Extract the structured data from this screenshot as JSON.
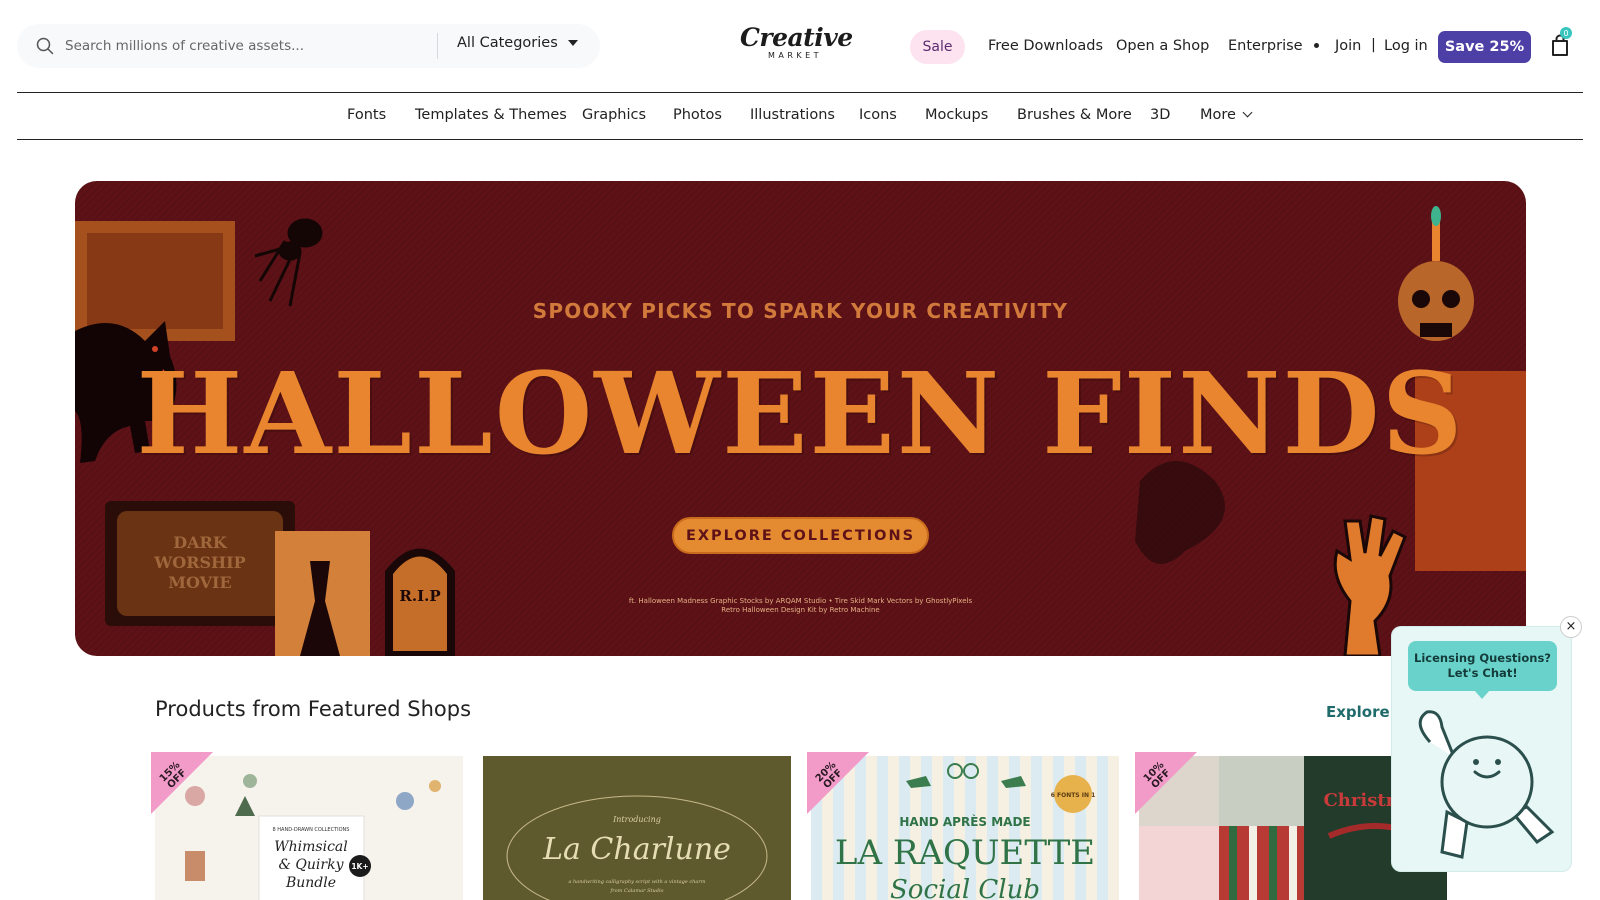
{
  "header": {
    "search": {
      "placeholder": "Search millions of creative assets...",
      "category": "All Categories"
    },
    "logo": {
      "line1": "Creative",
      "line2": "MARKET"
    },
    "nav": {
      "sale": "Sale",
      "free_downloads": "Free Downloads",
      "open_shop": "Open a Shop",
      "enterprise": "Enterprise",
      "join": "Join",
      "separator": "|",
      "login": "Log in",
      "save": "Save 25%",
      "cart_count": "0"
    }
  },
  "categories": [
    "Fonts",
    "Templates & Themes",
    "Graphics",
    "Photos",
    "Illustrations",
    "Icons",
    "Mockups",
    "Brushes & More",
    "3D",
    "More"
  ],
  "banner": {
    "tagline": "SPOOKY PICKS TO SPARK YOUR CREATIVITY",
    "headline": "HALLOWEEN FINDS",
    "cta": "EXPLORE COLLECTIONS",
    "credit_line1": "ft. Halloween Madness Graphic Stocks by ARQAM Studio • Tire Skid Mark Vectors by GhostlyPixels",
    "credit_line2": "Retro Halloween Design Kit by Retro Machine",
    "tv_text": "DARK WORSHIP MOVIE",
    "tombstone_text": "R.I.P",
    "colors": {
      "background": "#5e1217",
      "accent": "#e9852e"
    }
  },
  "featured": {
    "title": "Products from Featured Shops",
    "explore": "Explore F",
    "cards": [
      {
        "discount": "15% OFF",
        "title_lines": [
          "Whimsical",
          "& Quirky",
          "Bundle"
        ],
        "badge": "1K+",
        "sub": "8 HAND-DRAWN COLLECTIONS"
      },
      {
        "discount": "",
        "intro": "Introducing",
        "title": "La Charlune",
        "sub": "a handwriting calligraphy script with a vintage charm",
        "sub2": "from Calamar Studio"
      },
      {
        "discount": "20% OFF",
        "top": "HAND   APRÈS   MADE",
        "title": "LA RAQUETTE",
        "subtitle": "Social Club",
        "fonts_badge": "6 FONTS IN 1"
      },
      {
        "discount": "10% OFF",
        "title": "Christmas"
      }
    ]
  },
  "chat": {
    "line1": "Licensing Questions?",
    "line2": "Let's Chat!",
    "close": "×"
  }
}
